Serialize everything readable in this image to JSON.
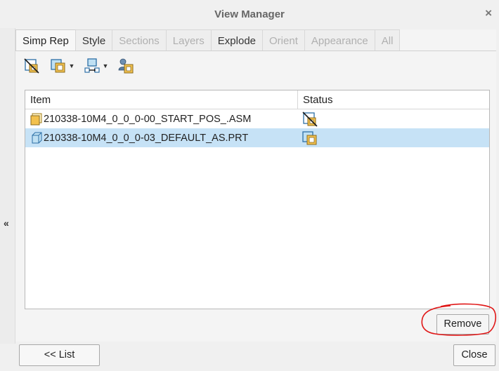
{
  "window": {
    "title": "View Manager",
    "close_glyph": "×"
  },
  "sidebar": {
    "collapse_glyph": "«"
  },
  "tabs": [
    {
      "label": "Simp Rep",
      "state": "active"
    },
    {
      "label": "Style",
      "state": "enabled"
    },
    {
      "label": "Sections",
      "state": "disabled"
    },
    {
      "label": "Layers",
      "state": "disabled"
    },
    {
      "label": "Explode",
      "state": "enabled"
    },
    {
      "label": "Orient",
      "state": "disabled"
    },
    {
      "label": "Appearance",
      "state": "disabled"
    },
    {
      "label": "All",
      "state": "disabled"
    }
  ],
  "toolbar": {
    "buttons": [
      "exclude-icon",
      "substitute-icon",
      "copy-rep-icon",
      "user-defined-icon"
    ],
    "dropdown_glyph": "▼"
  },
  "table": {
    "columns": [
      "Item",
      "Status"
    ],
    "rows": [
      {
        "item": "210338-10M4_0_0_0-00_START_POS_.ASM",
        "item_icon": "assembly-icon",
        "status_icon": "exclude-status-icon",
        "selected": false
      },
      {
        "item": "210338-10M4_0_0_0-03_DEFAULT_AS.PRT",
        "item_icon": "part-icon",
        "status_icon": "substitute-status-icon",
        "selected": true
      }
    ]
  },
  "actions": {
    "remove_label": "Remove",
    "list_label": "<< List",
    "close_label": "Close"
  },
  "colors": {
    "selection": "#c6e2f6",
    "annotation": "#e01818",
    "icon_yellow": "#f2c14e",
    "icon_blue": "#5aa7d6"
  }
}
